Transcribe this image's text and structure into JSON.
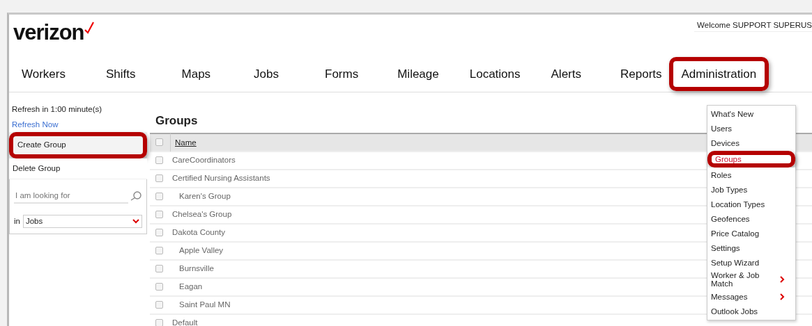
{
  "header": {
    "logo": "verizon",
    "welcome": "Welcome SUPPORT SUPERUS"
  },
  "nav": [
    {
      "label": "Workers",
      "highlighted": false
    },
    {
      "label": "Shifts",
      "highlighted": false
    },
    {
      "label": "Maps",
      "highlighted": false
    },
    {
      "label": "Jobs",
      "highlighted": false
    },
    {
      "label": "Forms",
      "highlighted": false
    },
    {
      "label": "Mileage",
      "highlighted": false
    },
    {
      "label": "Locations",
      "highlighted": false
    },
    {
      "label": "Alerts",
      "highlighted": false
    },
    {
      "label": "Reports",
      "highlighted": false
    },
    {
      "label": "Administration",
      "highlighted": true
    }
  ],
  "sidebar": {
    "refresh_text": "Refresh in 1:00 minute(s)",
    "refresh_link": "Refresh Now",
    "actions": [
      {
        "label": "Create Group",
        "highlighted": true
      },
      {
        "label": "Delete Group",
        "highlighted": false
      }
    ],
    "search": {
      "placeholder": "I am looking for"
    },
    "scope_label": "in",
    "scope_value": "Jobs"
  },
  "main": {
    "title": "Groups",
    "table": {
      "columns": [
        "Name"
      ],
      "all_selected": false,
      "rows": [
        {
          "name": "CareCoordinators",
          "checked": false
        },
        {
          "name": "Certified Nursing Assistants",
          "checked": false,
          "children": [
            {
              "name": "Karen's Group",
              "checked": false
            }
          ]
        },
        {
          "name": "Chelsea's Group",
          "checked": false
        },
        {
          "name": "Dakota County",
          "checked": false,
          "children": [
            {
              "name": "Apple Valley",
              "checked": false
            },
            {
              "name": "Burnsville",
              "checked": false
            },
            {
              "name": "Eagan",
              "checked": false
            },
            {
              "name": "Saint Paul MN",
              "checked": false
            }
          ]
        },
        {
          "name": "Default",
          "checked": false
        }
      ]
    }
  },
  "admin_menu": [
    {
      "label": "What's New",
      "selected": false,
      "submenu": false,
      "highlighted": false
    },
    {
      "label": "Users",
      "selected": false,
      "submenu": false,
      "highlighted": false
    },
    {
      "label": "Devices",
      "selected": false,
      "submenu": false,
      "highlighted": false
    },
    {
      "label": "Groups",
      "selected": true,
      "submenu": false,
      "highlighted": true
    },
    {
      "label": "Roles",
      "selected": false,
      "submenu": false,
      "highlighted": false
    },
    {
      "label": "Job Types",
      "selected": false,
      "submenu": false,
      "highlighted": false
    },
    {
      "label": "Location Types",
      "selected": false,
      "submenu": false,
      "highlighted": false
    },
    {
      "label": "Geofences",
      "selected": false,
      "submenu": false,
      "highlighted": false
    },
    {
      "label": "Price Catalog",
      "selected": false,
      "submenu": false,
      "highlighted": false
    },
    {
      "label": "Settings",
      "selected": false,
      "submenu": false,
      "highlighted": false
    },
    {
      "label": "Setup Wizard",
      "selected": false,
      "submenu": false,
      "highlighted": false
    },
    {
      "label": "Worker & Job Match",
      "selected": false,
      "submenu": true,
      "highlighted": false
    },
    {
      "label": "Messages",
      "selected": false,
      "submenu": true,
      "highlighted": false
    },
    {
      "label": "Outlook Jobs",
      "selected": false,
      "submenu": false,
      "highlighted": false
    }
  ]
}
